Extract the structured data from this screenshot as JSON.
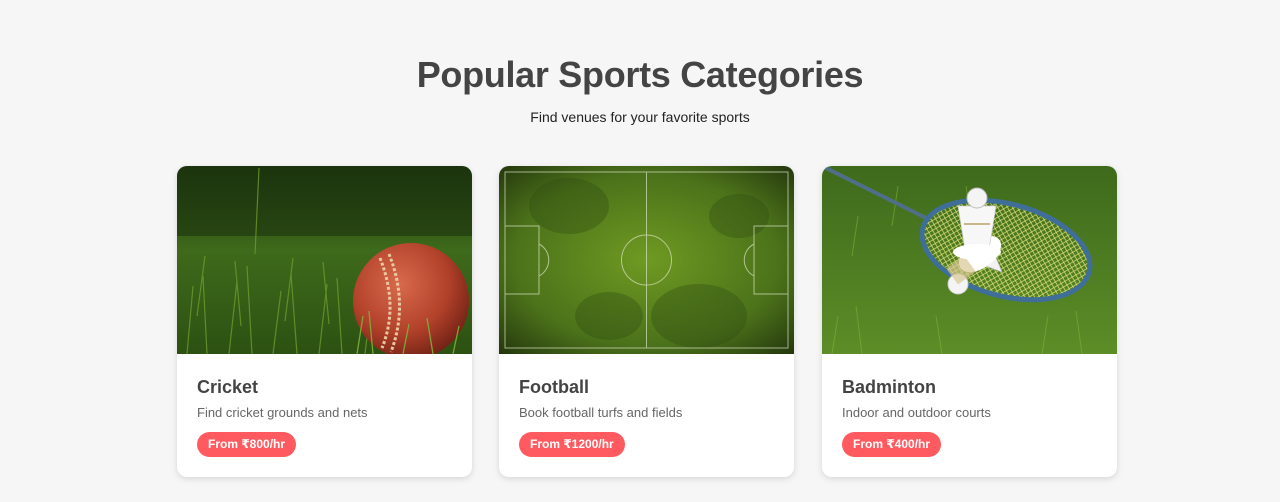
{
  "section": {
    "title": "Popular Sports Categories",
    "subtitle": "Find venues for your favorite sports"
  },
  "cards": [
    {
      "title": "Cricket",
      "description": "Find cricket grounds and nets",
      "price": "From ₹800/hr",
      "image": "cricket-ball-on-grass"
    },
    {
      "title": "Football",
      "description": "Book football turfs and fields",
      "price": "From ₹1200/hr",
      "image": "football-pitch-aerial"
    },
    {
      "title": "Badminton",
      "description": "Indoor and outdoor courts",
      "price": "From ₹400/hr",
      "image": "badminton-racket-and-shuttlecocks"
    }
  ],
  "colors": {
    "background": "#f6f6f6",
    "accent": "#ff5a5f",
    "heading": "#444444"
  }
}
